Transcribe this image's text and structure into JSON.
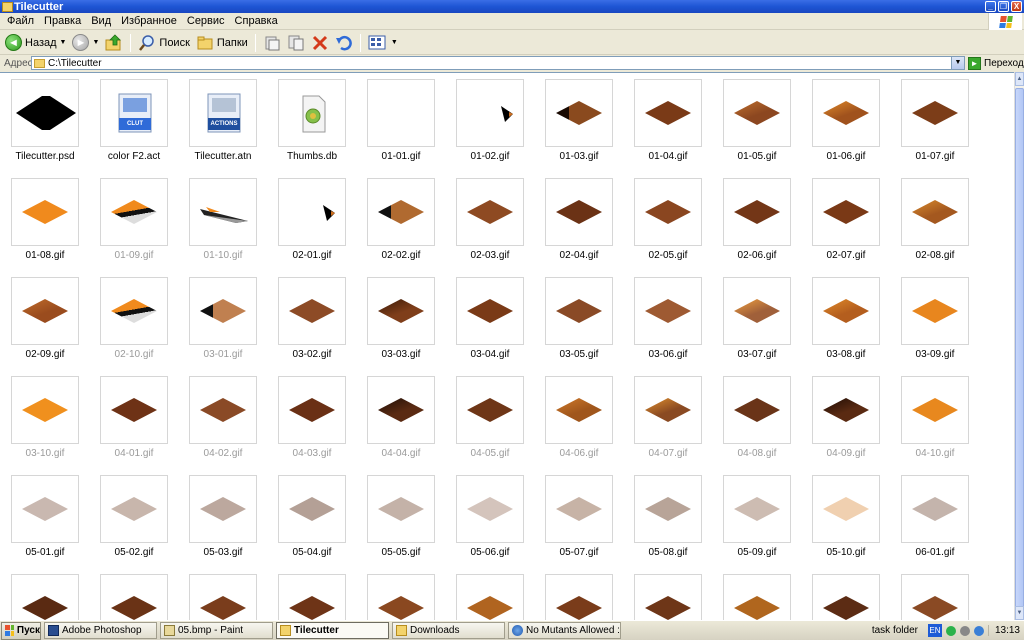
{
  "window": {
    "title": "Tilecutter",
    "buttons": [
      "_",
      "❐",
      "X"
    ]
  },
  "menu": [
    "Файл",
    "Правка",
    "Вид",
    "Избранное",
    "Сервис",
    "Справка"
  ],
  "toolbar": {
    "back_label": "Назад",
    "search_label": "Поиск",
    "folders_label": "Папки"
  },
  "address": {
    "label": "Адрес:",
    "path": "C:\\Tilecutter",
    "go_label": "Переход"
  },
  "files": [
    {
      "name": "Tilecutter.psd",
      "kind": "psd"
    },
    {
      "name": "color F2.act",
      "kind": "clut",
      "badge": "CLUT"
    },
    {
      "name": "Tilecutter.atn",
      "kind": "actions",
      "badge": "ACTIONS"
    },
    {
      "name": "Thumbs.db",
      "kind": "db"
    },
    {
      "name": "01-01.gif",
      "kind": "blank"
    },
    {
      "name": "01-02.gif",
      "kind": "corner"
    },
    {
      "name": "01-03.gif",
      "kind": "tile",
      "color": "#8a4a1e",
      "left": "#1a0a02"
    },
    {
      "name": "01-04.gif",
      "kind": "tile",
      "color": "#7a3a17"
    },
    {
      "name": "01-05.gif",
      "kind": "tile",
      "color": "#8c4720",
      "top": "#c0702e"
    },
    {
      "name": "01-06.gif",
      "kind": "tile",
      "color": "#a0521d",
      "top": "#e08a2a"
    },
    {
      "name": "01-07.gif",
      "kind": "tile",
      "color": "#7c3d18"
    },
    {
      "name": "01-08.gif",
      "kind": "tile",
      "color": "#f08a1d"
    },
    {
      "name": "01-09.gif",
      "kind": "tile",
      "color": "#f08a1d",
      "band": "#111"
    },
    {
      "name": "01-10.gif",
      "kind": "streak"
    },
    {
      "name": "02-01.gif",
      "kind": "corner"
    },
    {
      "name": "02-02.gif",
      "kind": "tile",
      "color": "#b06a30",
      "left": "#111"
    },
    {
      "name": "02-03.gif",
      "kind": "tile",
      "color": "#8e4a22"
    },
    {
      "name": "02-04.gif",
      "kind": "tile",
      "color": "#6b3215"
    },
    {
      "name": "02-05.gif",
      "kind": "tile",
      "color": "#8a4620"
    },
    {
      "name": "02-06.gif",
      "kind": "tile",
      "color": "#733617"
    },
    {
      "name": "02-07.gif",
      "kind": "tile",
      "color": "#7a3916"
    },
    {
      "name": "02-08.gif",
      "kind": "tile",
      "color": "#a4581f",
      "top": "#d98b2e"
    },
    {
      "name": "02-09.gif",
      "kind": "tile",
      "color": "#9a4c1e",
      "top": "#c06c2a"
    },
    {
      "name": "02-10.gif",
      "kind": "tile",
      "color": "#f08a1d",
      "band": "#111"
    },
    {
      "name": "03-01.gif",
      "kind": "tile",
      "color": "#c08050",
      "left": "#111"
    },
    {
      "name": "03-02.gif",
      "kind": "tile",
      "color": "#8d4b26"
    },
    {
      "name": "03-03.gif",
      "kind": "tile",
      "color": "#7f3e1a",
      "top": "#3a1a08"
    },
    {
      "name": "03-04.gif",
      "kind": "tile",
      "color": "#7a3a17"
    },
    {
      "name": "03-05.gif",
      "kind": "tile",
      "color": "#8a4a26"
    },
    {
      "name": "03-06.gif",
      "kind": "tile",
      "color": "#9e5a32"
    },
    {
      "name": "03-07.gif",
      "kind": "tile",
      "color": "#a0603a",
      "top": "#f0a040"
    },
    {
      "name": "03-08.gif",
      "kind": "tile",
      "color": "#b45e1e",
      "top": "#e08a2a"
    },
    {
      "name": "03-09.gif",
      "kind": "tile",
      "color": "#e8861e"
    },
    {
      "name": "03-10.gif",
      "kind": "tile",
      "color": "#f0901e"
    },
    {
      "name": "04-01.gif",
      "kind": "tile",
      "color": "#6e3216"
    },
    {
      "name": "04-02.gif",
      "kind": "tile",
      "color": "#8a4a26"
    },
    {
      "name": "04-03.gif",
      "kind": "tile",
      "color": "#6a3015"
    },
    {
      "name": "04-04.gif",
      "kind": "tile",
      "color": "#5a2a12",
      "top": "#201008"
    },
    {
      "name": "04-05.gif",
      "kind": "tile",
      "color": "#6e3617"
    },
    {
      "name": "04-06.gif",
      "kind": "tile",
      "color": "#a0561c",
      "top": "#d07a2a"
    },
    {
      "name": "04-07.gif",
      "kind": "tile",
      "color": "#8a4a22",
      "top": "#e0902e"
    },
    {
      "name": "04-08.gif",
      "kind": "tile",
      "color": "#6a3418"
    },
    {
      "name": "04-09.gif",
      "kind": "tile",
      "color": "#5a2a12",
      "top": "#1e0c04"
    },
    {
      "name": "04-10.gif",
      "kind": "tile",
      "color": "#e8881e"
    },
    {
      "name": "05-01.gif",
      "kind": "tile",
      "color": "#c9b8b0"
    },
    {
      "name": "05-02.gif",
      "kind": "tile",
      "color": "#c8b6ac"
    },
    {
      "name": "05-03.gif",
      "kind": "tile",
      "color": "#bca89e"
    },
    {
      "name": "05-04.gif",
      "kind": "tile",
      "color": "#b4a096"
    },
    {
      "name": "05-05.gif",
      "kind": "tile",
      "color": "#c4b2a8"
    },
    {
      "name": "05-06.gif",
      "kind": "tile",
      "color": "#d4c4bc"
    },
    {
      "name": "05-07.gif",
      "kind": "tile",
      "color": "#c7b3a6"
    },
    {
      "name": "05-08.gif",
      "kind": "tile",
      "color": "#b8a498"
    },
    {
      "name": "05-09.gif",
      "kind": "tile",
      "color": "#cdbcb2"
    },
    {
      "name": "05-10.gif",
      "kind": "tile",
      "color": "#f0d0b0"
    },
    {
      "name": "06-01.gif",
      "kind": "tile",
      "color": "#c4b4ac"
    },
    {
      "name": "",
      "kind": "tile",
      "color": "#5a2a12"
    },
    {
      "name": "",
      "kind": "tile",
      "color": "#6a3316"
    },
    {
      "name": "",
      "kind": "tile",
      "color": "#7a3d1c"
    },
    {
      "name": "",
      "kind": "tile",
      "color": "#6e3417"
    },
    {
      "name": "",
      "kind": "tile",
      "color": "#8a4820"
    },
    {
      "name": "",
      "kind": "tile",
      "color": "#b06420"
    },
    {
      "name": "",
      "kind": "tile",
      "color": "#7a3c1a"
    },
    {
      "name": "",
      "kind": "tile",
      "color": "#6e3618"
    },
    {
      "name": "",
      "kind": "tile",
      "color": "#b0661e"
    },
    {
      "name": "",
      "kind": "tile",
      "color": "#5c2c14"
    },
    {
      "name": "",
      "kind": "tile",
      "color": "#8a4a24"
    }
  ],
  "faded_captions": [
    "01-09.gif",
    "01-10.gif",
    "02-10.gif",
    "03-01.gif",
    "03-10.gif",
    "04-01.gif",
    "04-02.gif",
    "04-03.gif",
    "04-04.gif",
    "04-05.gif",
    "04-06.gif",
    "04-07.gif",
    "04-08.gif",
    "04-09.gif",
    "04-10.gif"
  ],
  "taskbar": {
    "start_label": "Пуск",
    "tasks": [
      {
        "label": "Adobe Photoshop",
        "active": false
      },
      {
        "label": "05.bmp - Paint",
        "active": false
      },
      {
        "label": "Tilecutter",
        "active": true
      },
      {
        "label": "Downloads",
        "active": false
      },
      {
        "label": "No Mutants Allowed :: Al...",
        "active": false
      }
    ],
    "tray_text": "task folder",
    "lang": "EN",
    "clock": "13:13"
  }
}
